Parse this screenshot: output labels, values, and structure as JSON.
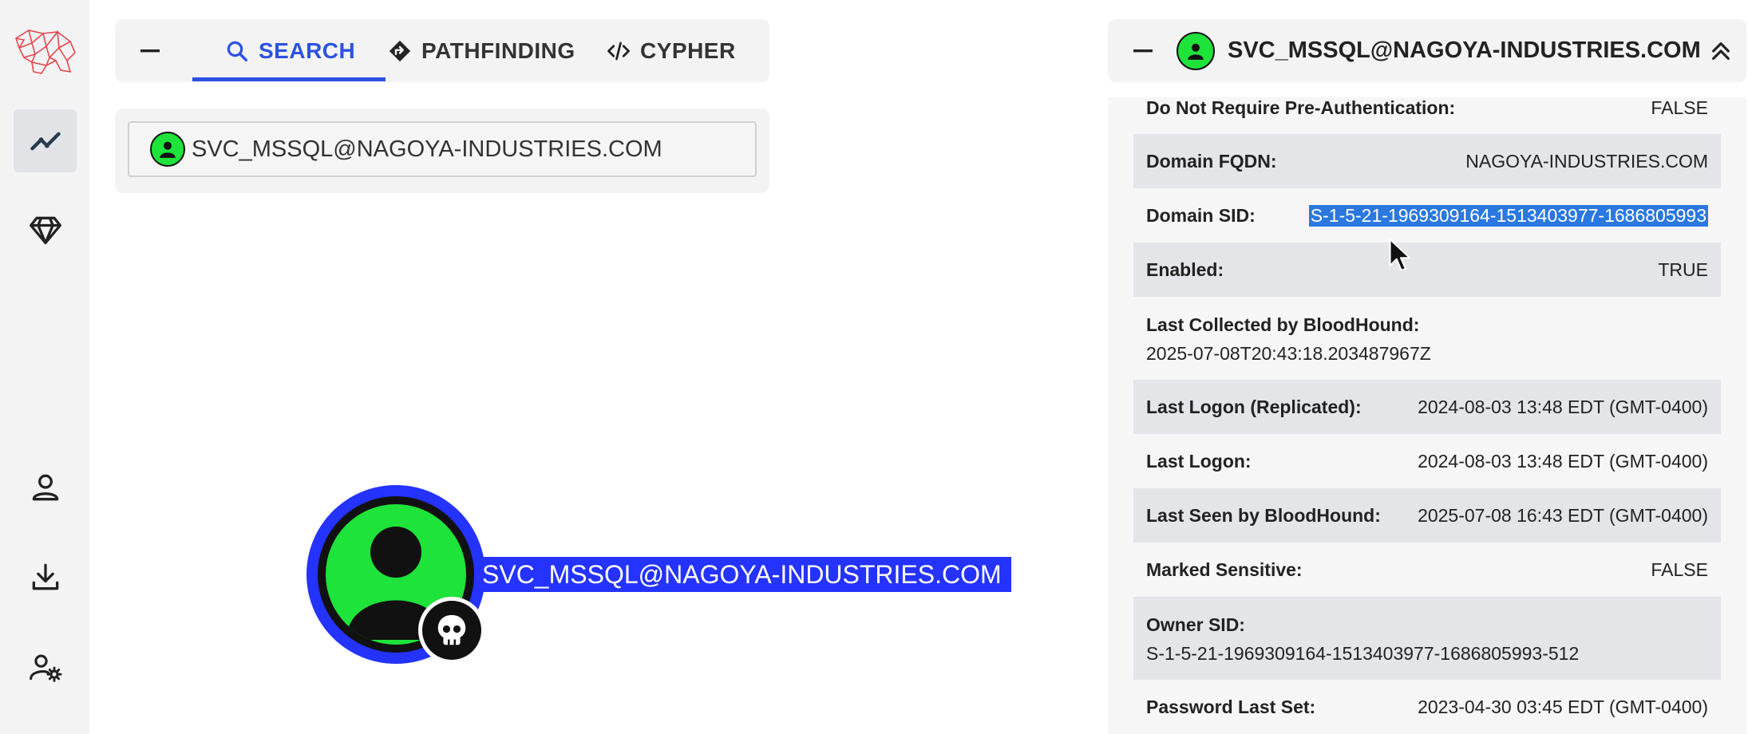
{
  "search": {
    "tabs": [
      {
        "label": "SEARCH",
        "icon": "search-icon",
        "active": true
      },
      {
        "label": "PATHFINDING",
        "icon": "diamond-direction-icon",
        "active": false
      },
      {
        "label": "CYPHER",
        "icon": "code-icon",
        "active": false
      }
    ],
    "query_value": "SVC_MSSQL@NAGOYA-INDUSTRIES.COM"
  },
  "graph": {
    "node_label": "SVC_MSSQL@NAGOYA-INDUSTRIES.COM",
    "node_color": "#1ee33a",
    "highlight_color": "#2433ff"
  },
  "panel": {
    "title": "SVC_MSSQL@NAGOYA-INDUSTRIES.COM",
    "properties": [
      {
        "key": "Do Not Require Pre-Authentication:",
        "value": "FALSE"
      },
      {
        "key": "Domain FQDN:",
        "value": "NAGOYA-INDUSTRIES.COM"
      },
      {
        "key": "Domain SID:",
        "value": "S-1-5-21-1969309164-1513403977-1686805993",
        "selected": true
      },
      {
        "key": "Enabled:",
        "value": "TRUE"
      },
      {
        "key": "Last Collected by BloodHound:",
        "value": "2025-07-08T20:43:18.203487967Z"
      },
      {
        "key": "Last Logon (Replicated):",
        "value": "2024-08-03 13:48 EDT (GMT-0400)"
      },
      {
        "key": "Last Logon:",
        "value": "2024-08-03 13:48 EDT (GMT-0400)"
      },
      {
        "key": "Last Seen by BloodHound:",
        "value": "2025-07-08 16:43 EDT (GMT-0400)"
      },
      {
        "key": "Marked Sensitive:",
        "value": "FALSE"
      },
      {
        "key": "Owner SID:",
        "value": "S-1-5-21-1969309164-1513403977-1686805993-512"
      },
      {
        "key": "Password Last Set:",
        "value": "2023-04-30 03:45 EDT (GMT-0400)"
      }
    ]
  },
  "nav": {
    "items": [
      "bloodhound-logo",
      "explore-icon",
      "group-management-icon",
      "profile-icon",
      "download-icon",
      "administration-icon"
    ]
  },
  "colors": {
    "accent": "#2c52e0",
    "selection": "#2a78e0"
  }
}
